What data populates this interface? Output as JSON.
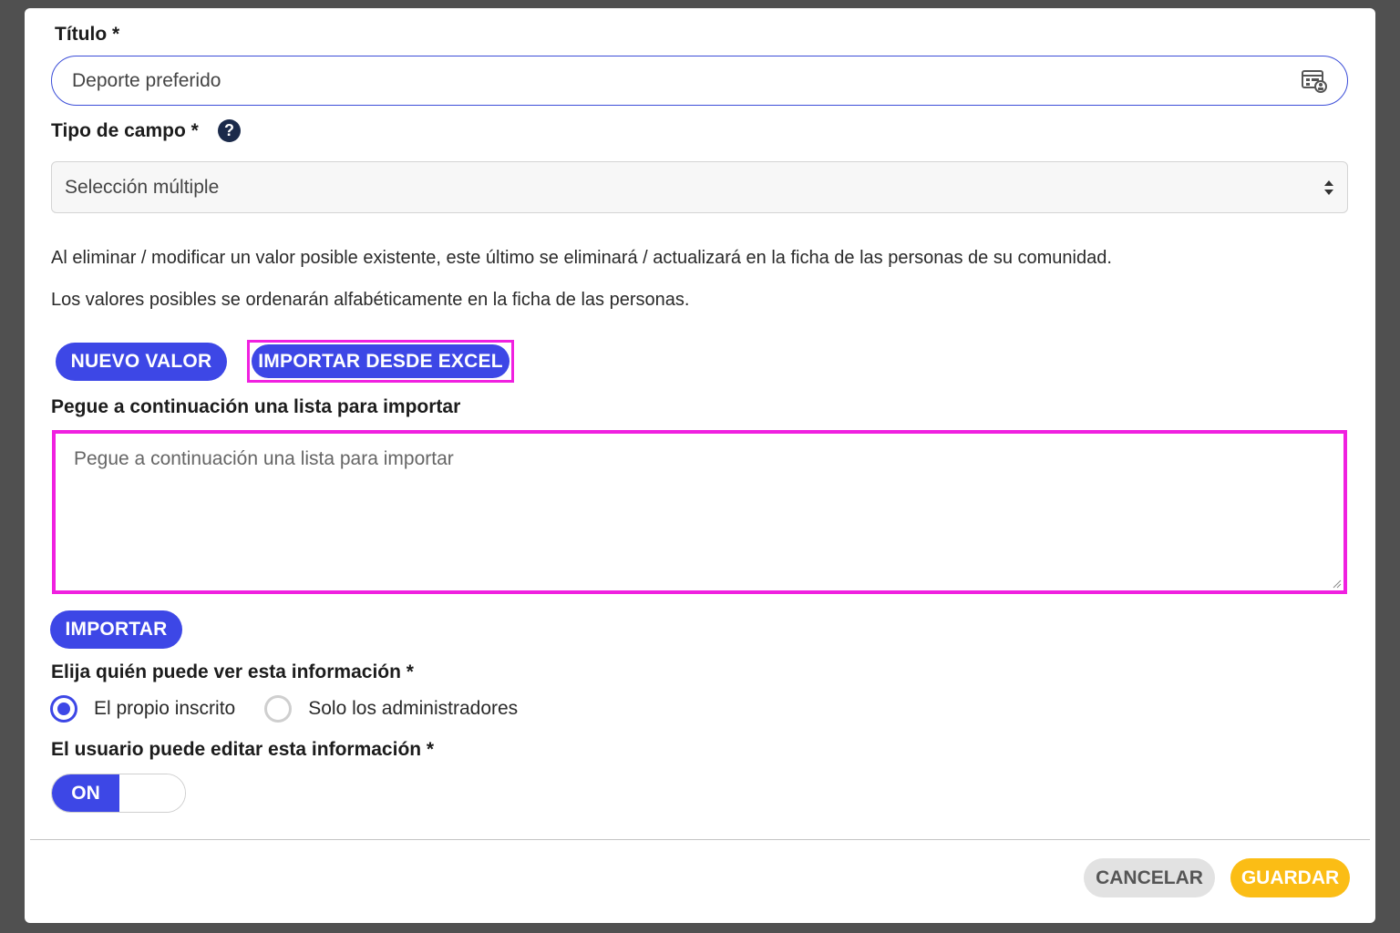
{
  "form": {
    "title_label": "Título  *",
    "title_value": "Deporte preferido",
    "field_type_label": "Tipo de campo  *",
    "help_glyph": "?",
    "field_type_value": "Selección múltiple",
    "note_1": "Al eliminar / modificar un valor posible existente, este último se eliminará / actualizará en la ficha de las personas de su comunidad.",
    "note_2": "Los valores posibles se ordenarán alfabéticamente en la ficha de las personas.",
    "new_value_button": "NUEVO VALOR",
    "import_excel_button": "IMPORTAR DESDE EXCEL",
    "paste_label": "Pegue a continuación una lista para importar",
    "paste_placeholder": "Pegue a continuación una lista para importar",
    "import_button": "IMPORTAR",
    "visibility_label": "Elija quién puede ver esta información *",
    "visibility_options": [
      {
        "label": "El propio inscrito",
        "selected": true
      },
      {
        "label": "Solo los administradores",
        "selected": false
      }
    ],
    "editable_label": "El usuario puede editar esta información *",
    "toggle_on_label": "ON"
  },
  "footer": {
    "cancel_label": "CANCELAR",
    "save_label": "GUARDAR"
  },
  "colors": {
    "primary": "#3d47e6",
    "highlight": "#f020e0",
    "save": "#fbbd15",
    "cancel_bg": "#e2e2e2"
  },
  "icons": {
    "translate": "translate-icon",
    "help": "help-icon",
    "select_arrows": "sort-arrows-icon"
  }
}
